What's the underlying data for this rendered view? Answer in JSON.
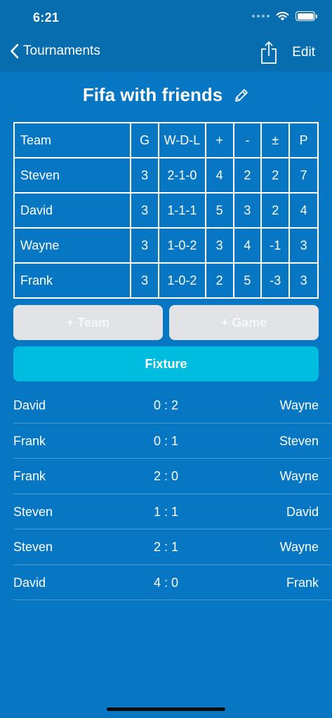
{
  "status_bar": {
    "time": "6:21",
    "icons": [
      "signal-dots-icon",
      "wifi-icon",
      "battery-icon"
    ]
  },
  "nav": {
    "back_label": "Tournaments",
    "back_icon": "chevron-left-icon",
    "share_icon": "share-icon",
    "edit_label": "Edit"
  },
  "tournament": {
    "title": "Fifa with friends",
    "edit_icon": "pencil-icon"
  },
  "standings": {
    "columns": [
      "Team",
      "G",
      "W-D-L",
      "+",
      "-",
      "±",
      "P"
    ],
    "rows": [
      [
        "Steven",
        "3",
        "2-1-0",
        "4",
        "2",
        "2",
        "7"
      ],
      [
        "David",
        "3",
        "1-1-1",
        "5",
        "3",
        "2",
        "4"
      ],
      [
        "Wayne",
        "3",
        "1-0-2",
        "3",
        "4",
        "-1",
        "3"
      ],
      [
        "Frank",
        "3",
        "1-0-2",
        "2",
        "5",
        "-3",
        "3"
      ]
    ]
  },
  "buttons": {
    "add_team": "+ Team",
    "add_game": "+ Game",
    "fixture": "Fixture"
  },
  "fixtures": [
    {
      "home": "David",
      "score": "0 : 2",
      "away": "Wayne"
    },
    {
      "home": "Frank",
      "score": "0 : 1",
      "away": "Steven"
    },
    {
      "home": "Frank",
      "score": "2 : 0",
      "away": "Wayne"
    },
    {
      "home": "Steven",
      "score": "1 : 1",
      "away": "David"
    },
    {
      "home": "Steven",
      "score": "2 : 1",
      "away": "Wayne"
    },
    {
      "home": "David",
      "score": "4 : 0",
      "away": "Frank"
    }
  ],
  "colors": {
    "background": "#0777c4",
    "nav_background": "#076daf",
    "fixture_button": "#00bde0",
    "disabled_button": "#e1e3e6"
  }
}
